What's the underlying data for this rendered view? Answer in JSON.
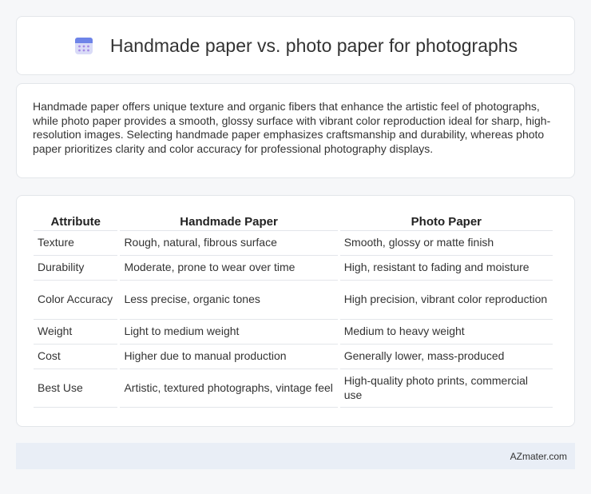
{
  "header": {
    "title": "Handmade paper vs. photo paper for photographs",
    "icon": "calendar-icon",
    "icon_color": "#7d7fe0"
  },
  "summary": {
    "text": "Handmade paper offers unique texture and organic fibers that enhance the artistic feel of photographs, while photo paper provides a smooth, glossy surface with vibrant color reproduction ideal for sharp, high-resolution images. Selecting handmade paper emphasizes craftsmanship and durability, whereas photo paper prioritizes clarity and color accuracy for professional photography displays."
  },
  "table": {
    "headers": [
      "Attribute",
      "Handmade Paper",
      "Photo Paper"
    ],
    "rows": [
      [
        "Texture",
        "Rough, natural, fibrous surface",
        "Smooth, glossy or matte finish"
      ],
      [
        "Durability",
        "Moderate, prone to wear over time",
        "High, resistant to fading and moisture"
      ],
      [
        "Color Accuracy",
        "Less precise, organic tones",
        "High precision, vibrant color reproduction"
      ],
      [
        "Weight",
        "Light to medium weight",
        "Medium to heavy weight"
      ],
      [
        "Cost",
        "Higher due to manual production",
        "Generally lower, mass-produced"
      ],
      [
        "Best Use",
        "Artistic, textured photographs, vintage feel",
        "High-quality photo prints, commercial use"
      ]
    ]
  },
  "footer": {
    "brand": "AZmater.com",
    "background": "#e9eef6"
  }
}
